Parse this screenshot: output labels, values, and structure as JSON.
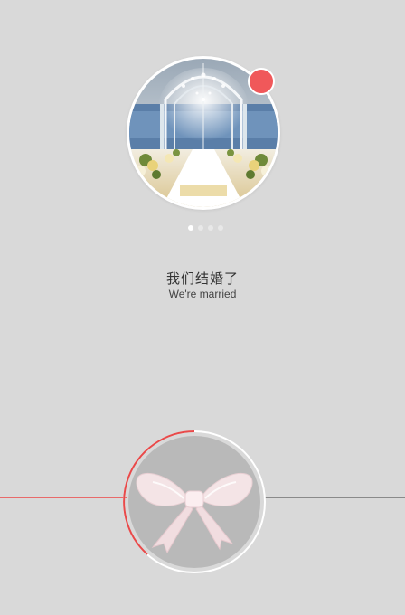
{
  "cover": {
    "image_alt": "Wedding hall with white aisle and glass archway",
    "has_notification_badge": true,
    "badge_color": "#f0585a"
  },
  "pager": {
    "count": 4,
    "active_index": 0
  },
  "headline": {
    "title": "我们结婚了",
    "subtitle": "We're married"
  },
  "dial": {
    "icon": "bow-icon",
    "progress_color": "#e84a4a",
    "track_color": "#ffffff",
    "fill_color": "#b9b9b9"
  }
}
